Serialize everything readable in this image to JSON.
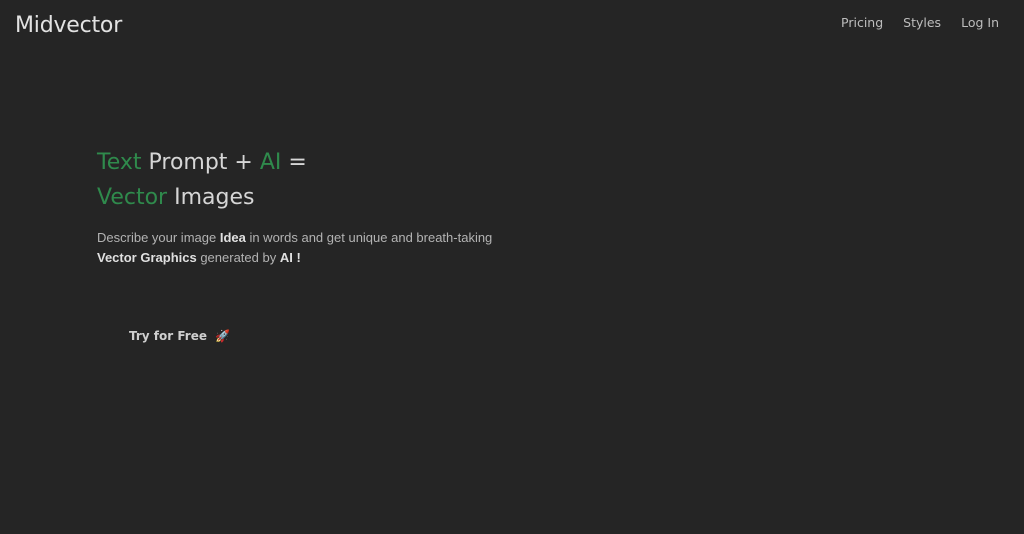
{
  "header": {
    "logo": "Midvector",
    "nav": [
      "Pricing",
      "Styles",
      "Log In"
    ]
  },
  "hero": {
    "line1": {
      "w1": "Text",
      "w2": "Prompt +",
      "w3": "AI",
      "w4": "="
    },
    "line2": {
      "w1": "Vector",
      "w2": "Images"
    },
    "desc": {
      "p1": "Describe your image ",
      "b1": "Idea",
      "p2": " in words and get unique and breath-taking",
      "b2": "Vector Graphics",
      "p3": " generated by ",
      "b3": "AI !"
    },
    "cta_label": "Try for Free",
    "cta_icon": "rocket-icon"
  },
  "colors": {
    "background": "#252525",
    "accent_green": "#2f8a4c",
    "text": "#d6d6d6"
  }
}
